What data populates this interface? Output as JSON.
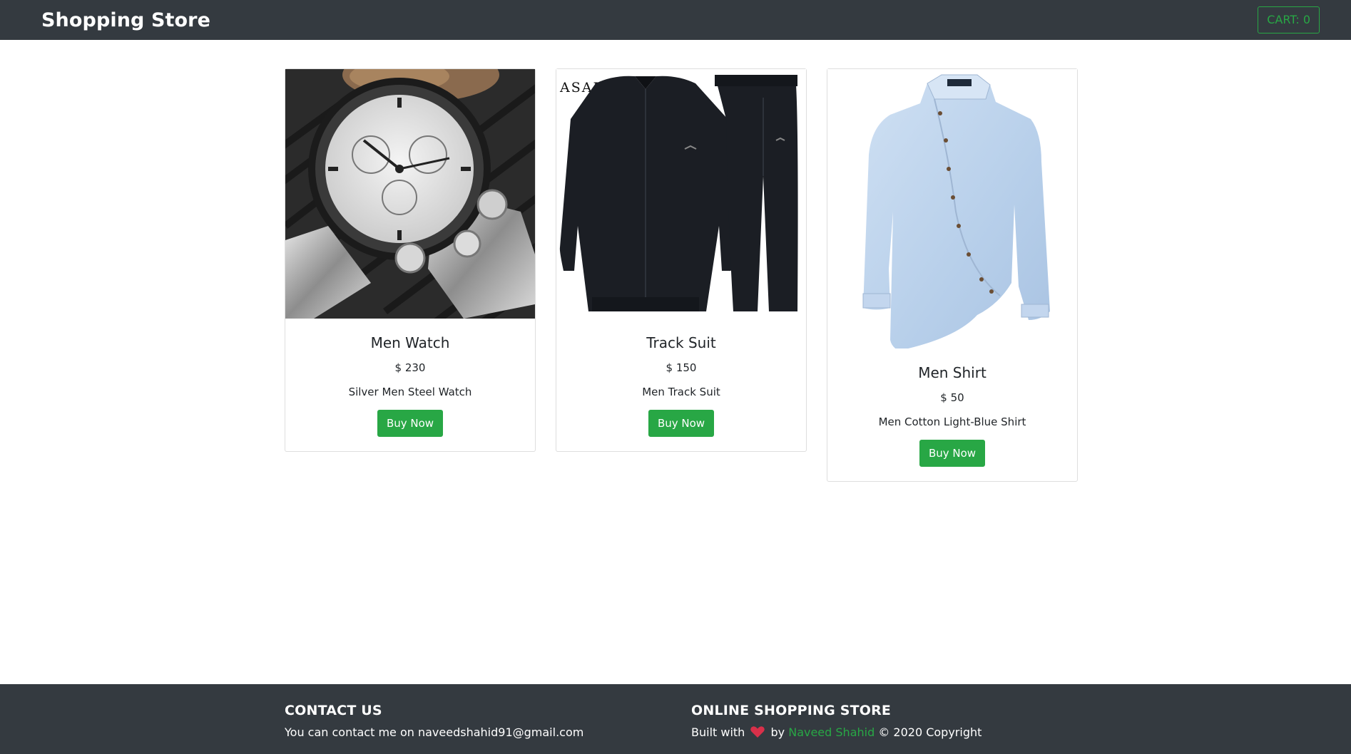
{
  "navbar": {
    "brand": "Shopping Store",
    "cart_label": "CART: 0"
  },
  "products": [
    {
      "title": "Men Watch",
      "price": "$ 230",
      "description": "Silver Men Steel Watch",
      "button": "Buy Now"
    },
    {
      "title": "Track Suit",
      "price": "$ 150",
      "description": "Men Track Suit",
      "button": "Buy Now",
      "image_brand": "ASALI"
    },
    {
      "title": "Men Shirt",
      "price": "$ 50",
      "description": "Men Cotton Light-Blue Shirt",
      "button": "Buy Now"
    }
  ],
  "footer": {
    "contact_heading": "CONTACT US",
    "contact_text": "You can contact me on naveedshahid91@gmail.com",
    "store_heading": "ONLINE SHOPPING STORE",
    "built_with": "Built with",
    "by": "by",
    "author": "Naveed Shahid",
    "copyright": "© 2020 Copyright"
  },
  "colors": {
    "navbar_bg": "#343a40",
    "accent": "#28a745",
    "footer_bg": "#343a40"
  }
}
